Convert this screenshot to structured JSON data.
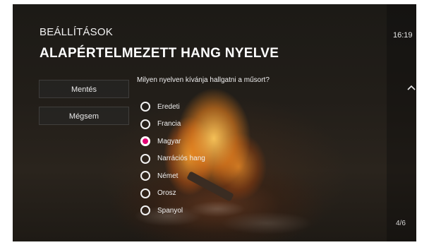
{
  "header": {
    "section_title": "BEÁLLÍTÁSOK",
    "page_title": "ALAPÉRTELMEZETT HANG NYELVE",
    "clock": "16:19"
  },
  "actions": {
    "save_label": "Mentés",
    "cancel_label": "Mégsem"
  },
  "question": "Milyen nyelven kívánja hallgatni a műsort?",
  "options": [
    {
      "label": "Eredeti",
      "selected": false
    },
    {
      "label": "Francia",
      "selected": false
    },
    {
      "label": "Magyar",
      "selected": true
    },
    {
      "label": "Narrációs hang",
      "selected": false
    },
    {
      "label": "Német",
      "selected": false
    },
    {
      "label": "Orosz",
      "selected": false
    },
    {
      "label": "Spanyol",
      "selected": false
    }
  ],
  "pagination": "4/6",
  "icons": {
    "scroll_up": "chevron-up-icon"
  },
  "colors": {
    "accent": "#e20074"
  }
}
